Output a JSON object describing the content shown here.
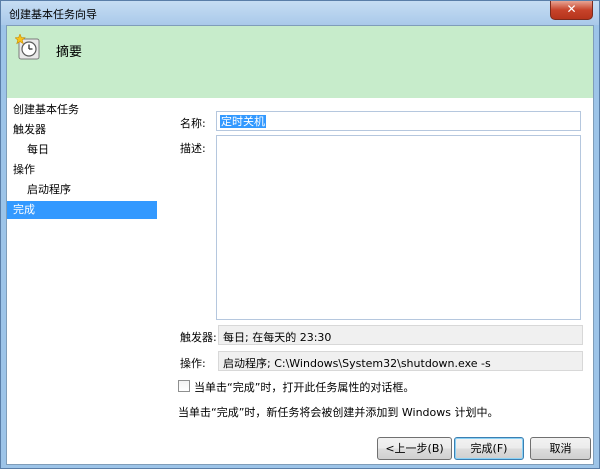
{
  "window": {
    "title": "创建基本任务向导",
    "close_glyph": "✕"
  },
  "banner": {
    "title": "摘要",
    "icon": "clock-star-icon"
  },
  "nav": {
    "items": [
      {
        "label": "创建基本任务",
        "indent": false,
        "selected": false
      },
      {
        "label": "触发器",
        "indent": false,
        "selected": false
      },
      {
        "label": "每日",
        "indent": true,
        "selected": false
      },
      {
        "label": "操作",
        "indent": false,
        "selected": false
      },
      {
        "label": "启动程序",
        "indent": true,
        "selected": false
      },
      {
        "label": "完成",
        "indent": false,
        "selected": true
      }
    ]
  },
  "form": {
    "name_label": "名称:",
    "name_value": "定时关机",
    "desc_label": "描述:",
    "desc_value": "",
    "trigger_label": "触发器:",
    "trigger_value": "每日; 在每天的 23:30",
    "action_label": "操作:",
    "action_value": "启动程序; C:\\Windows\\System32\\shutdown.exe -s",
    "checkbox_label": "当单击“完成”时，打开此任务属性的对话框。",
    "checkbox_checked": false,
    "info_text": "当单击“完成”时，新任务将会被创建并添加到 Windows 计划中。"
  },
  "buttons": {
    "back": "<上一步(B)",
    "finish": "完成(F)",
    "cancel": "取消"
  },
  "colors": {
    "banner": "#c7eccb",
    "selection": "#3399ff"
  }
}
